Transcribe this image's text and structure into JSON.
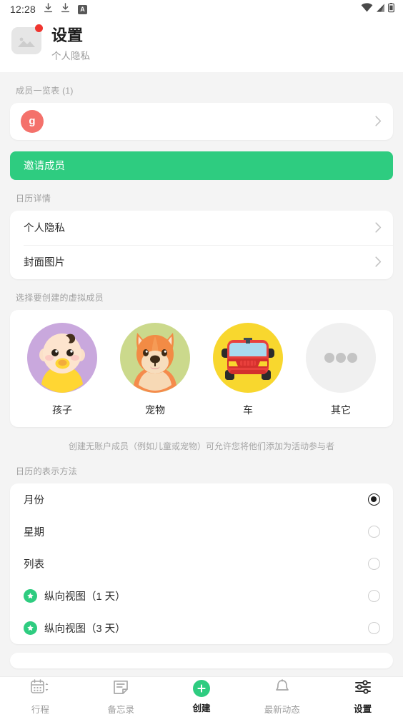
{
  "statusbar": {
    "time": "12:28",
    "left_icons": [
      "download-icon",
      "download-icon",
      "letter-a-badge-icon"
    ],
    "a_badge": "A",
    "right_icons": [
      "wifi-icon",
      "cellular-signal-icon",
      "battery-icon"
    ]
  },
  "header": {
    "title": "设置",
    "subtitle": "个人隐私",
    "thumb_icon": "image-placeholder-icon",
    "badge_color": "#f0352f"
  },
  "members": {
    "section_label": "成员一览表 (1)",
    "rows": [
      {
        "initial": "g",
        "avatar_color": "#f4716b",
        "chevron": "chevron-right-icon"
      }
    ],
    "invite_label": "邀请成员",
    "invite_color": "#2ecc80"
  },
  "calendar_details": {
    "section_label": "日历详情",
    "rows": [
      {
        "label": "个人隐私"
      },
      {
        "label": "封面图片"
      }
    ]
  },
  "virtual_members": {
    "section_label": "选择要创建的虚拟成员",
    "items": [
      {
        "label": "孩子",
        "icon": "baby-avatar-icon",
        "bg": "#c9a8dd"
      },
      {
        "label": "宠物",
        "icon": "dog-avatar-icon",
        "bg": "#cbd98c"
      },
      {
        "label": "车",
        "icon": "car-avatar-icon",
        "bg": "#f8d72e"
      },
      {
        "label": "其它",
        "icon": "ellipsis-avatar-icon",
        "bg": "#f0f0f0"
      }
    ],
    "hint": "创建无账户成员（例如儿童或宠物）可允许您将他们添加为活动参与者"
  },
  "display_method": {
    "section_label": "日历的表示方法",
    "options": [
      {
        "label": "月份",
        "selected": true,
        "premium": false
      },
      {
        "label": "星期",
        "selected": false,
        "premium": false
      },
      {
        "label": "列表",
        "selected": false,
        "premium": false
      },
      {
        "label": "纵向视图（1 天）",
        "selected": false,
        "premium": true
      },
      {
        "label": "纵向视图（3 天）",
        "selected": false,
        "premium": true
      }
    ]
  },
  "bottomnav": {
    "items": [
      {
        "label": "行程",
        "icon": "calendar-switch-icon",
        "active": false
      },
      {
        "label": "备忘录",
        "icon": "note-icon",
        "active": false
      },
      {
        "label": "创建",
        "icon": "plus-circle-icon",
        "active": false
      },
      {
        "label": "最新动态",
        "icon": "bell-icon",
        "active": false
      },
      {
        "label": "设置",
        "icon": "sliders-icon",
        "active": true
      }
    ]
  }
}
